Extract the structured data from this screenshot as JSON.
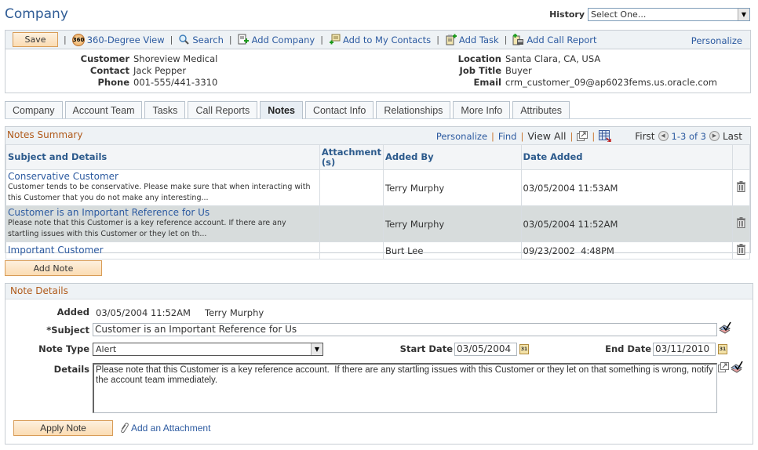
{
  "header": {
    "title": "Company",
    "history_label": "History",
    "history_value": "Select One..."
  },
  "toolbar": {
    "save": "Save",
    "items": [
      {
        "label": "360-Degree View",
        "icon": "360-icon"
      },
      {
        "label": "Search",
        "icon": "search-icon"
      },
      {
        "label": "Add Company",
        "icon": "add-company-icon"
      },
      {
        "label": "Add to My Contacts",
        "icon": "add-contacts-icon"
      },
      {
        "label": "Add Task",
        "icon": "add-task-icon"
      },
      {
        "label": "Add Call Report",
        "icon": "add-call-report-icon"
      }
    ],
    "personalize": "Personalize"
  },
  "info": {
    "left": [
      {
        "label": "Customer",
        "value": "Shoreview Medical"
      },
      {
        "label": "Contact",
        "value": "Jack Pepper"
      },
      {
        "label": "Phone",
        "value": "001-555/441-3310"
      }
    ],
    "right": [
      {
        "label": "Location",
        "value": "Santa Clara, CA, USA"
      },
      {
        "label": "Job Title",
        "value": "Buyer"
      },
      {
        "label": "Email",
        "value": "crm_customer_09@ap6023fems.us.oracle.com"
      }
    ]
  },
  "tabs": [
    {
      "label": "Company",
      "active": false
    },
    {
      "label": "Account Team",
      "active": false
    },
    {
      "label": "Tasks",
      "active": false
    },
    {
      "label": "Call Reports",
      "active": false
    },
    {
      "label": "Notes",
      "active": true
    },
    {
      "label": "Contact Info",
      "active": false
    },
    {
      "label": "Relationships",
      "active": false
    },
    {
      "label": "More Info",
      "active": false
    },
    {
      "label": "Attributes",
      "active": false
    }
  ],
  "notes_summary": {
    "title": "Notes Summary",
    "nav": {
      "personalize": "Personalize",
      "find": "Find",
      "view_all": "View All",
      "first": "First",
      "range": "1-3 of 3",
      "last": "Last"
    },
    "columns": [
      "Subject and Details",
      "Attachment (s)",
      "Added By",
      "Date Added"
    ],
    "rows": [
      {
        "subject": "Conservative Customer",
        "details": "Customer tends to be conservative. Please make sure that when interacting with this Customer that you do not make any interesting...",
        "attachment": "",
        "added_by": "Terry Murphy",
        "date_added": "03/05/2004 11:53AM",
        "selected": false
      },
      {
        "subject": "Customer is an Important Reference for Us",
        "details": "Please note that this Customer is a key reference account. If there are any startling issues with this Customer or they let on th...",
        "attachment": "",
        "added_by": "Terry Murphy",
        "date_added": "03/05/2004 11:52AM",
        "selected": true
      },
      {
        "subject": "Important Customer",
        "details": "",
        "attachment": "",
        "added_by": "Burt Lee",
        "date_added": "09/23/2002  4:48PM",
        "selected": false
      }
    ],
    "add_note": "Add Note"
  },
  "note_details": {
    "title": "Note Details",
    "added_label": "Added",
    "added_date": "03/05/2004 11:52AM",
    "added_by": "Terry Murphy",
    "subject_label": "*Subject",
    "subject_value": "Customer is an Important Reference for Us",
    "note_type_label": "Note Type",
    "note_type_value": "Alert",
    "start_date_label": "Start Date",
    "start_date_value": "03/05/2004",
    "end_date_label": "End Date",
    "end_date_value": "03/11/2010",
    "details_label": "Details",
    "details_value": "Please note that this Customer is a key reference account.  If there are any startling issues with this Customer or they let on that something is wrong, notify the account team immediately.",
    "apply_note": "Apply Note",
    "add_attachment": "Add an Attachment",
    "calendar_glyph": "31"
  }
}
